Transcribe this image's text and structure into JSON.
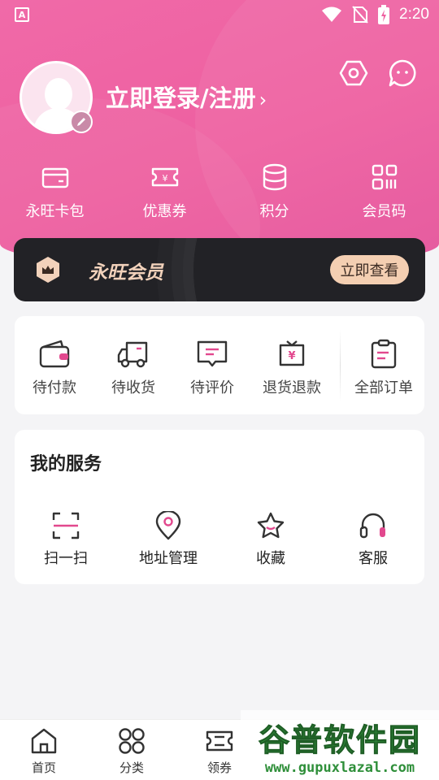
{
  "status_bar": {
    "time": "2:20",
    "app_badge": "A"
  },
  "header": {
    "login_label": "立即登录/注册",
    "login_chevron": "›",
    "quick_links": [
      {
        "label": "永旺卡包",
        "icon": "wallet-card-icon"
      },
      {
        "label": "优惠券",
        "icon": "coupon-icon"
      },
      {
        "label": "积分",
        "icon": "points-database-icon"
      },
      {
        "label": "会员码",
        "icon": "member-code-icon"
      }
    ],
    "settings_icon": "hexagon-settings-icon",
    "message_icon": "chat-bubble-icon"
  },
  "member_banner": {
    "title": "永旺会员",
    "button": "立即查看"
  },
  "orders": {
    "items": [
      {
        "label": "待付款",
        "icon": "wallet-icon"
      },
      {
        "label": "待收货",
        "icon": "truck-icon"
      },
      {
        "label": "待评价",
        "icon": "comment-icon"
      },
      {
        "label": "退货退款",
        "icon": "refund-icon"
      },
      {
        "label": "全部订单",
        "icon": "clipboard-icon"
      }
    ]
  },
  "services": {
    "title": "我的服务",
    "items": [
      {
        "label": "扫一扫",
        "icon": "scan-icon"
      },
      {
        "label": "地址管理",
        "icon": "location-pin-icon"
      },
      {
        "label": "收藏",
        "icon": "star-icon"
      },
      {
        "label": "客服",
        "icon": "headset-icon"
      }
    ]
  },
  "tabbar": {
    "tabs": [
      {
        "label": "首页",
        "icon": "home-icon"
      },
      {
        "label": "分类",
        "icon": "category-grid-icon"
      },
      {
        "label": "领券",
        "icon": "ticket-icon"
      }
    ]
  },
  "watermark": {
    "title": "谷普软件园",
    "url": "www.gupuxlazal.com"
  },
  "colors": {
    "brand_pink": "#ee5fa0",
    "accent_pink": "#e2488e",
    "member_gold": "#f4cfb2",
    "member_bg": "#222226"
  }
}
